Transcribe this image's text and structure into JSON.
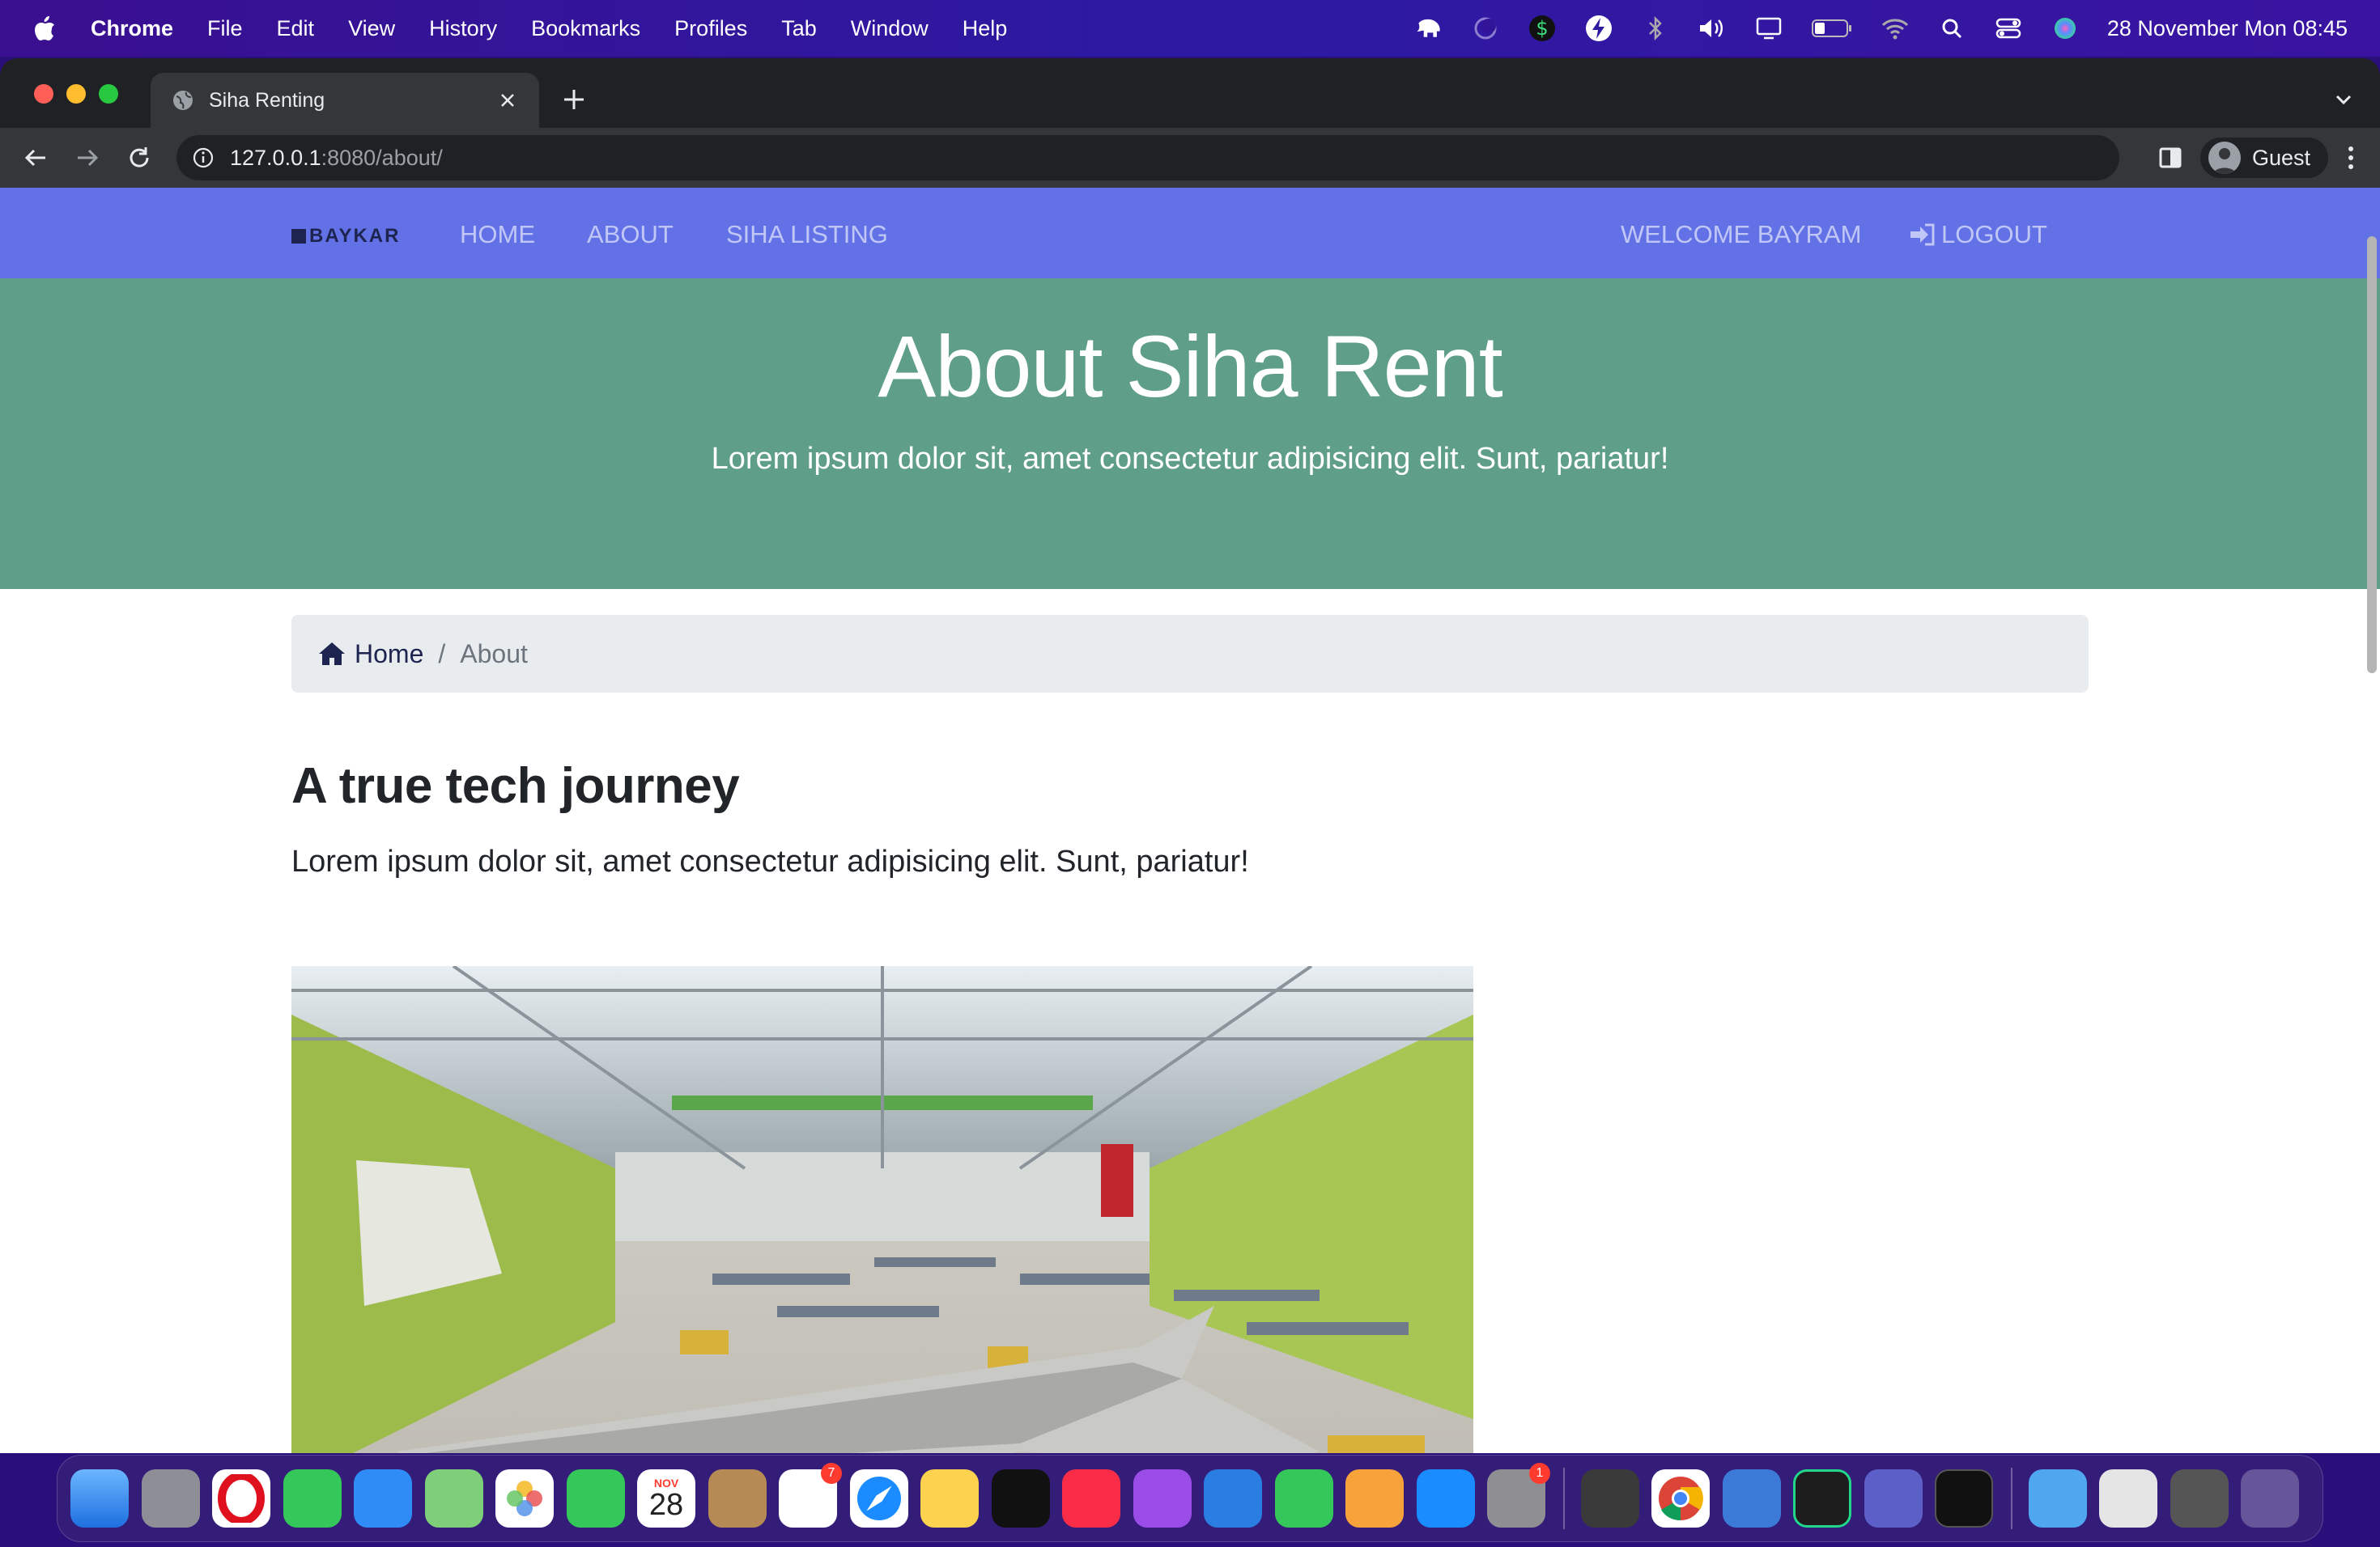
{
  "menubar": {
    "items": [
      "Chrome",
      "File",
      "Edit",
      "View",
      "History",
      "Bookmarks",
      "Profiles",
      "Tab",
      "Window",
      "Help"
    ],
    "clock": "28 November Mon  08:45",
    "status_icons": [
      "elephant-icon",
      "focus-moon-icon",
      "dollar-icon",
      "bolt-icon",
      "bluetooth-icon",
      "volume-icon",
      "display-icon",
      "battery-icon",
      "wifi-icon",
      "search-icon",
      "control-center-icon",
      "siri-icon"
    ]
  },
  "browser": {
    "tab_title": "Siha Renting",
    "url_host": "127.0.0.1",
    "url_path": ":8080/about/",
    "profile_label": "Guest"
  },
  "site": {
    "logo_text": "BAYKAR",
    "nav": {
      "home": "HOME",
      "about": "ABOUT",
      "listing": "SIHA LISTING",
      "welcome": "WELCOME BAYRAM",
      "logout": "LOGOUT"
    },
    "hero": {
      "title": "About Siha Rent",
      "subtitle": "Lorem ipsum dolor sit, amet consectetur adipisicing elit. Sunt, pariatur!"
    },
    "breadcrumb": {
      "home": "Home",
      "separator": "/",
      "current": "About"
    },
    "section": {
      "title": "A true tech journey",
      "text": "Lorem ipsum dolor sit, amet consectetur adipisicing elit. Sunt, pariatur!"
    },
    "colors": {
      "navbar": "#6272e6",
      "hero": "#5f9e88",
      "breadcrumb_bg": "#e9ecef"
    }
  },
  "dock": {
    "calendar_month": "NOV",
    "calendar_day": "28",
    "reminders_badge": "7",
    "settings_badge": "1",
    "apps": [
      "finder",
      "launchpad",
      "opera",
      "messages",
      "mail",
      "maps",
      "photos",
      "facetime",
      "calendar",
      "contacts",
      "reminders",
      "safari",
      "notes",
      "apple-tv",
      "music",
      "podcasts",
      "keynote",
      "numbers",
      "pages",
      "app-store",
      "system-preferences",
      "sublime-text",
      "chrome",
      "tableplus",
      "pycharm",
      "teams",
      "terminal",
      "downloads-folder",
      "screenshot-stack-1",
      "screenshot-stack-2",
      "trash"
    ]
  }
}
